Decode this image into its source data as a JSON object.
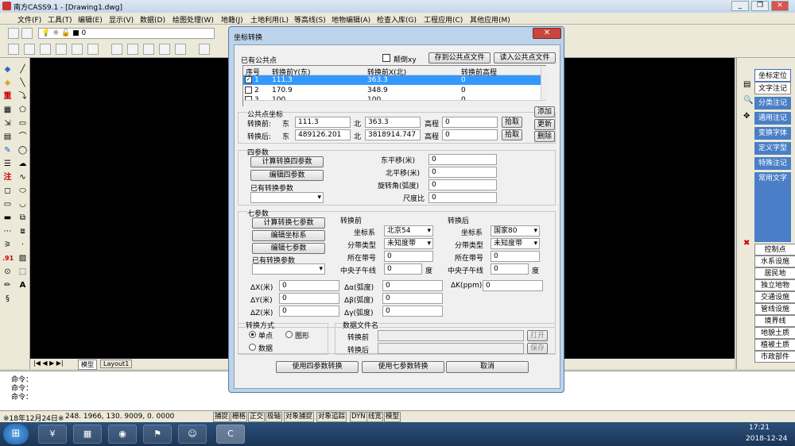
{
  "app": {
    "title": "南方CASS9.1 - [Drawing1.dwg]"
  },
  "menu": [
    "文件(F)",
    "工具(T)",
    "编辑(E)",
    "显示(V)",
    "数据(D)",
    "绘图处理(W)",
    "地籍(J)",
    "土地利用(L)",
    "等高线(S)",
    "地物编辑(A)",
    "检查入库(G)",
    "工程应用(C)",
    "其他应用(M)"
  ],
  "toolbar": {
    "layer_value": "0"
  },
  "tabs": [
    "模型",
    "Layout1"
  ],
  "command_lines": [
    "命令：",
    "命令：",
    "命令："
  ],
  "status": {
    "date": "※18年12月24日※",
    "coords": "248. 1966, 130. 9009, 0. 0000",
    "buttons": [
      "捕捉",
      "栅格",
      "正交",
      "极轴",
      "对象捕捉",
      "对象追踪",
      "DYN",
      "线宽",
      "模型"
    ]
  },
  "taskbar": {
    "time": "17:21",
    "date": "2018-12-24"
  },
  "right_panel": {
    "buttons": [
      "坐标定位",
      "文字注记",
      "分类注记",
      "通用注记",
      "变换字体",
      "定义字型",
      "特殊注记",
      "常用文字"
    ],
    "labels": [
      "控制点",
      "水系设施",
      "居民地",
      "独立地物",
      "交通设施",
      "管线设施",
      "境界线",
      "地貌土质",
      "植被土质",
      "市政部件"
    ]
  },
  "dialog": {
    "title": "坐标转换",
    "close": "✕",
    "common_points": {
      "label": "已有公共点",
      "reverse_label": "颠倒xy",
      "save_btn": "存到公共点文件",
      "load_btn": "读入公共点文件",
      "headers": [
        "序号",
        "转换前Y(东)",
        "转换前X(北)",
        "转换前高程"
      ],
      "rows": [
        [
          "1",
          "111.3",
          "363.3",
          "0"
        ],
        [
          "2",
          "170.9",
          "348.9",
          "0"
        ],
        [
          "3",
          "100",
          "100",
          "0"
        ]
      ]
    },
    "point_coords": {
      "label": "公共点坐标",
      "before_label": "转换前:",
      "after_label": "转换后:",
      "east": "东",
      "north": "北",
      "elev": "高程",
      "before": {
        "e": "111.3",
        "n": "363.3",
        "h": "0"
      },
      "after": {
        "e": "489126.201",
        "n": "3818914.747",
        "h": "0"
      },
      "pick": "拾取",
      "add": "添加",
      "update": "更新",
      "delete": "删除"
    },
    "four": {
      "label": "四参数",
      "calc": "计算转换四参数",
      "edit": "编辑四参数",
      "existing": "已有转换参数",
      "east_shift": "东平移(米)",
      "north_shift": "北平移(米)",
      "rotation": "旋转角(弧度)",
      "scale": "尺度比",
      "values": [
        "0",
        "0",
        "0",
        "0"
      ]
    },
    "seven": {
      "label": "七参数",
      "calc": "计算转换七参数",
      "edit_coord": "编辑坐标系",
      "edit": "编辑七参数",
      "existing": "已有转换参数",
      "before": {
        "label": "转换前",
        "cs_label": "坐标系",
        "cs": "北京54",
        "zone_label": "分带类型",
        "zone": "未知度带",
        "band_label": "所在带号",
        "band": "0",
        "cm_label": "中央子午线",
        "cm": "0",
        "deg": "度"
      },
      "after": {
        "label": "转换后",
        "cs_label": "坐标系",
        "cs": "国家80",
        "zone_label": "分带类型",
        "zone": "未知度带",
        "band_label": "所在带号",
        "band": "0",
        "cm_label": "中央子午线",
        "cm": "0",
        "deg": "度"
      },
      "dx": "ΔX(米)",
      "dy": "ΔY(米)",
      "dz": "ΔZ(米)",
      "da": "Δα(弧度)",
      "db": "Δβ(弧度)",
      "dg": "Δγ(弧度)",
      "dk": "ΔK(ppm)",
      "vals": [
        "0",
        "0",
        "0",
        "0",
        "0",
        "0",
        "0"
      ]
    },
    "mode": {
      "label": "转换方式",
      "single": "单点",
      "graphic": "图形",
      "data": "数据"
    },
    "files": {
      "label": "数据文件名",
      "before": "转换前",
      "after": "转换后",
      "open": "打开",
      "save": "保存"
    },
    "actions": {
      "four": "使用四参数转换",
      "seven": "使用七参数转换",
      "cancel": "取消"
    }
  }
}
